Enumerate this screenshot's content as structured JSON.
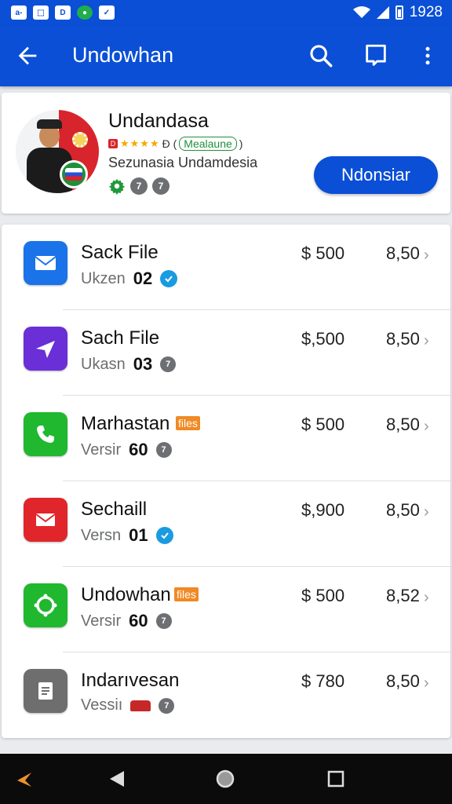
{
  "status_bar": {
    "left_icons": [
      "mail-icon",
      "image-icon",
      "b-app-icon",
      "whatsapp-icon",
      "shield-icon"
    ],
    "left_glyphs": [
      "a-",
      "⬚",
      "D",
      "●",
      "✓"
    ],
    "time": "1928"
  },
  "app_bar": {
    "title": "Undowhan",
    "back_icon": "arrow-left-icon",
    "actions": [
      "search-icon",
      "message-icon",
      "more-vert-icon"
    ]
  },
  "profile": {
    "name": "Undandasa",
    "rating_badge": "D",
    "stars": "★★★★",
    "rating_suffix": "Ɖ (",
    "tag": "Mealaune",
    "tag_close": ")",
    "subtitle": "Sezunasia  Undamdesia",
    "badge_1": "7",
    "badge_2": "7",
    "button_label": "Ndonsiar"
  },
  "list": {
    "items": [
      {
        "name": "Sack File",
        "icon": "mail-icon",
        "icon_color": "#1a73e8",
        "tag": "",
        "version_label": "Ukzen",
        "version": "02",
        "status": "verified",
        "price": "$ 500",
        "price2": "8,50"
      },
      {
        "name": "Sach File",
        "icon": "send-icon",
        "icon_color": "#6a2fd6",
        "tag": "",
        "version_label": "Ukasn",
        "version": "03",
        "status": "grey",
        "status_text": "7",
        "price": "$,500",
        "price2": "8,50"
      },
      {
        "name": "Marhastan",
        "icon": "phone-icon",
        "icon_color": "#1fb82f",
        "tag": "files",
        "version_label": "Versir",
        "version": "60",
        "status": "grey",
        "status_text": "7",
        "price": "$ 500",
        "price2": "8,50"
      },
      {
        "name": "Sechaill",
        "icon": "envelope-icon",
        "icon_color": "#e0262b",
        "tag": "",
        "version_label": "Versn",
        "version": "01",
        "status": "verified",
        "price": "$,900",
        "price2": "8,50"
      },
      {
        "name": "Undowhan",
        "icon": "settings-icon",
        "icon_color": "#1fb82f",
        "tag": "files",
        "version_label": "Versir",
        "version": "60",
        "status": "grey",
        "status_text": "7",
        "price": "$ 500",
        "price2": "8,52"
      },
      {
        "name": "Indarıvesan",
        "icon": "document-icon",
        "icon_color": "#6e6e6e",
        "tag": "",
        "version_label": "Vessiı",
        "version": "",
        "status": "car",
        "status_text": "7",
        "price": "$ 780",
        "price2": "8,50"
      }
    ]
  },
  "nav_bar": {
    "icons": [
      "app-launcher-icon",
      "back-triangle-icon",
      "home-circle-icon",
      "recents-square-icon"
    ]
  }
}
